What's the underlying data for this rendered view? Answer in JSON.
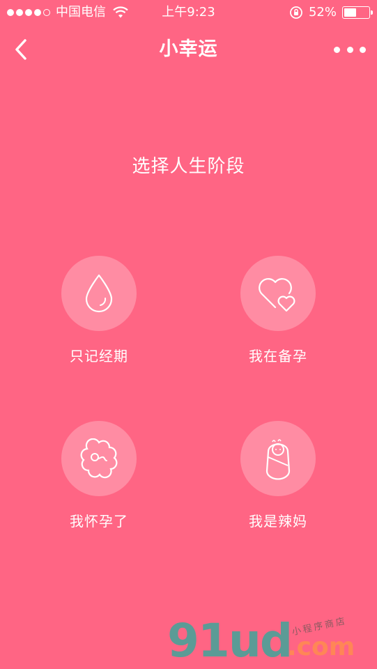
{
  "status_bar": {
    "carrier": "中国电信",
    "time": "上午9:23",
    "battery_percent": "52%",
    "battery_level": 0.52,
    "signal_bars": 4
  },
  "nav": {
    "title": "小幸运",
    "back_icon": "chevron-left-icon",
    "more_icon": "more-dots-icon"
  },
  "page": {
    "heading": "选择人生阶段"
  },
  "options": [
    {
      "label": "只记经期",
      "icon": "drop-icon"
    },
    {
      "label": "我在备孕",
      "icon": "hearts-icon"
    },
    {
      "label": "我怀孕了",
      "icon": "flower-embryo-icon"
    },
    {
      "label": "我是辣妈",
      "icon": "swaddled-baby-icon"
    }
  ],
  "watermark": {
    "text": "91ud",
    "suffix": ".com",
    "tagline": "小程序商店",
    "colors": {
      "text": "#3fa59a",
      "suffix": "#ff8a52"
    }
  },
  "colors": {
    "background": "#ff6584",
    "foreground": "#ffffff"
  }
}
